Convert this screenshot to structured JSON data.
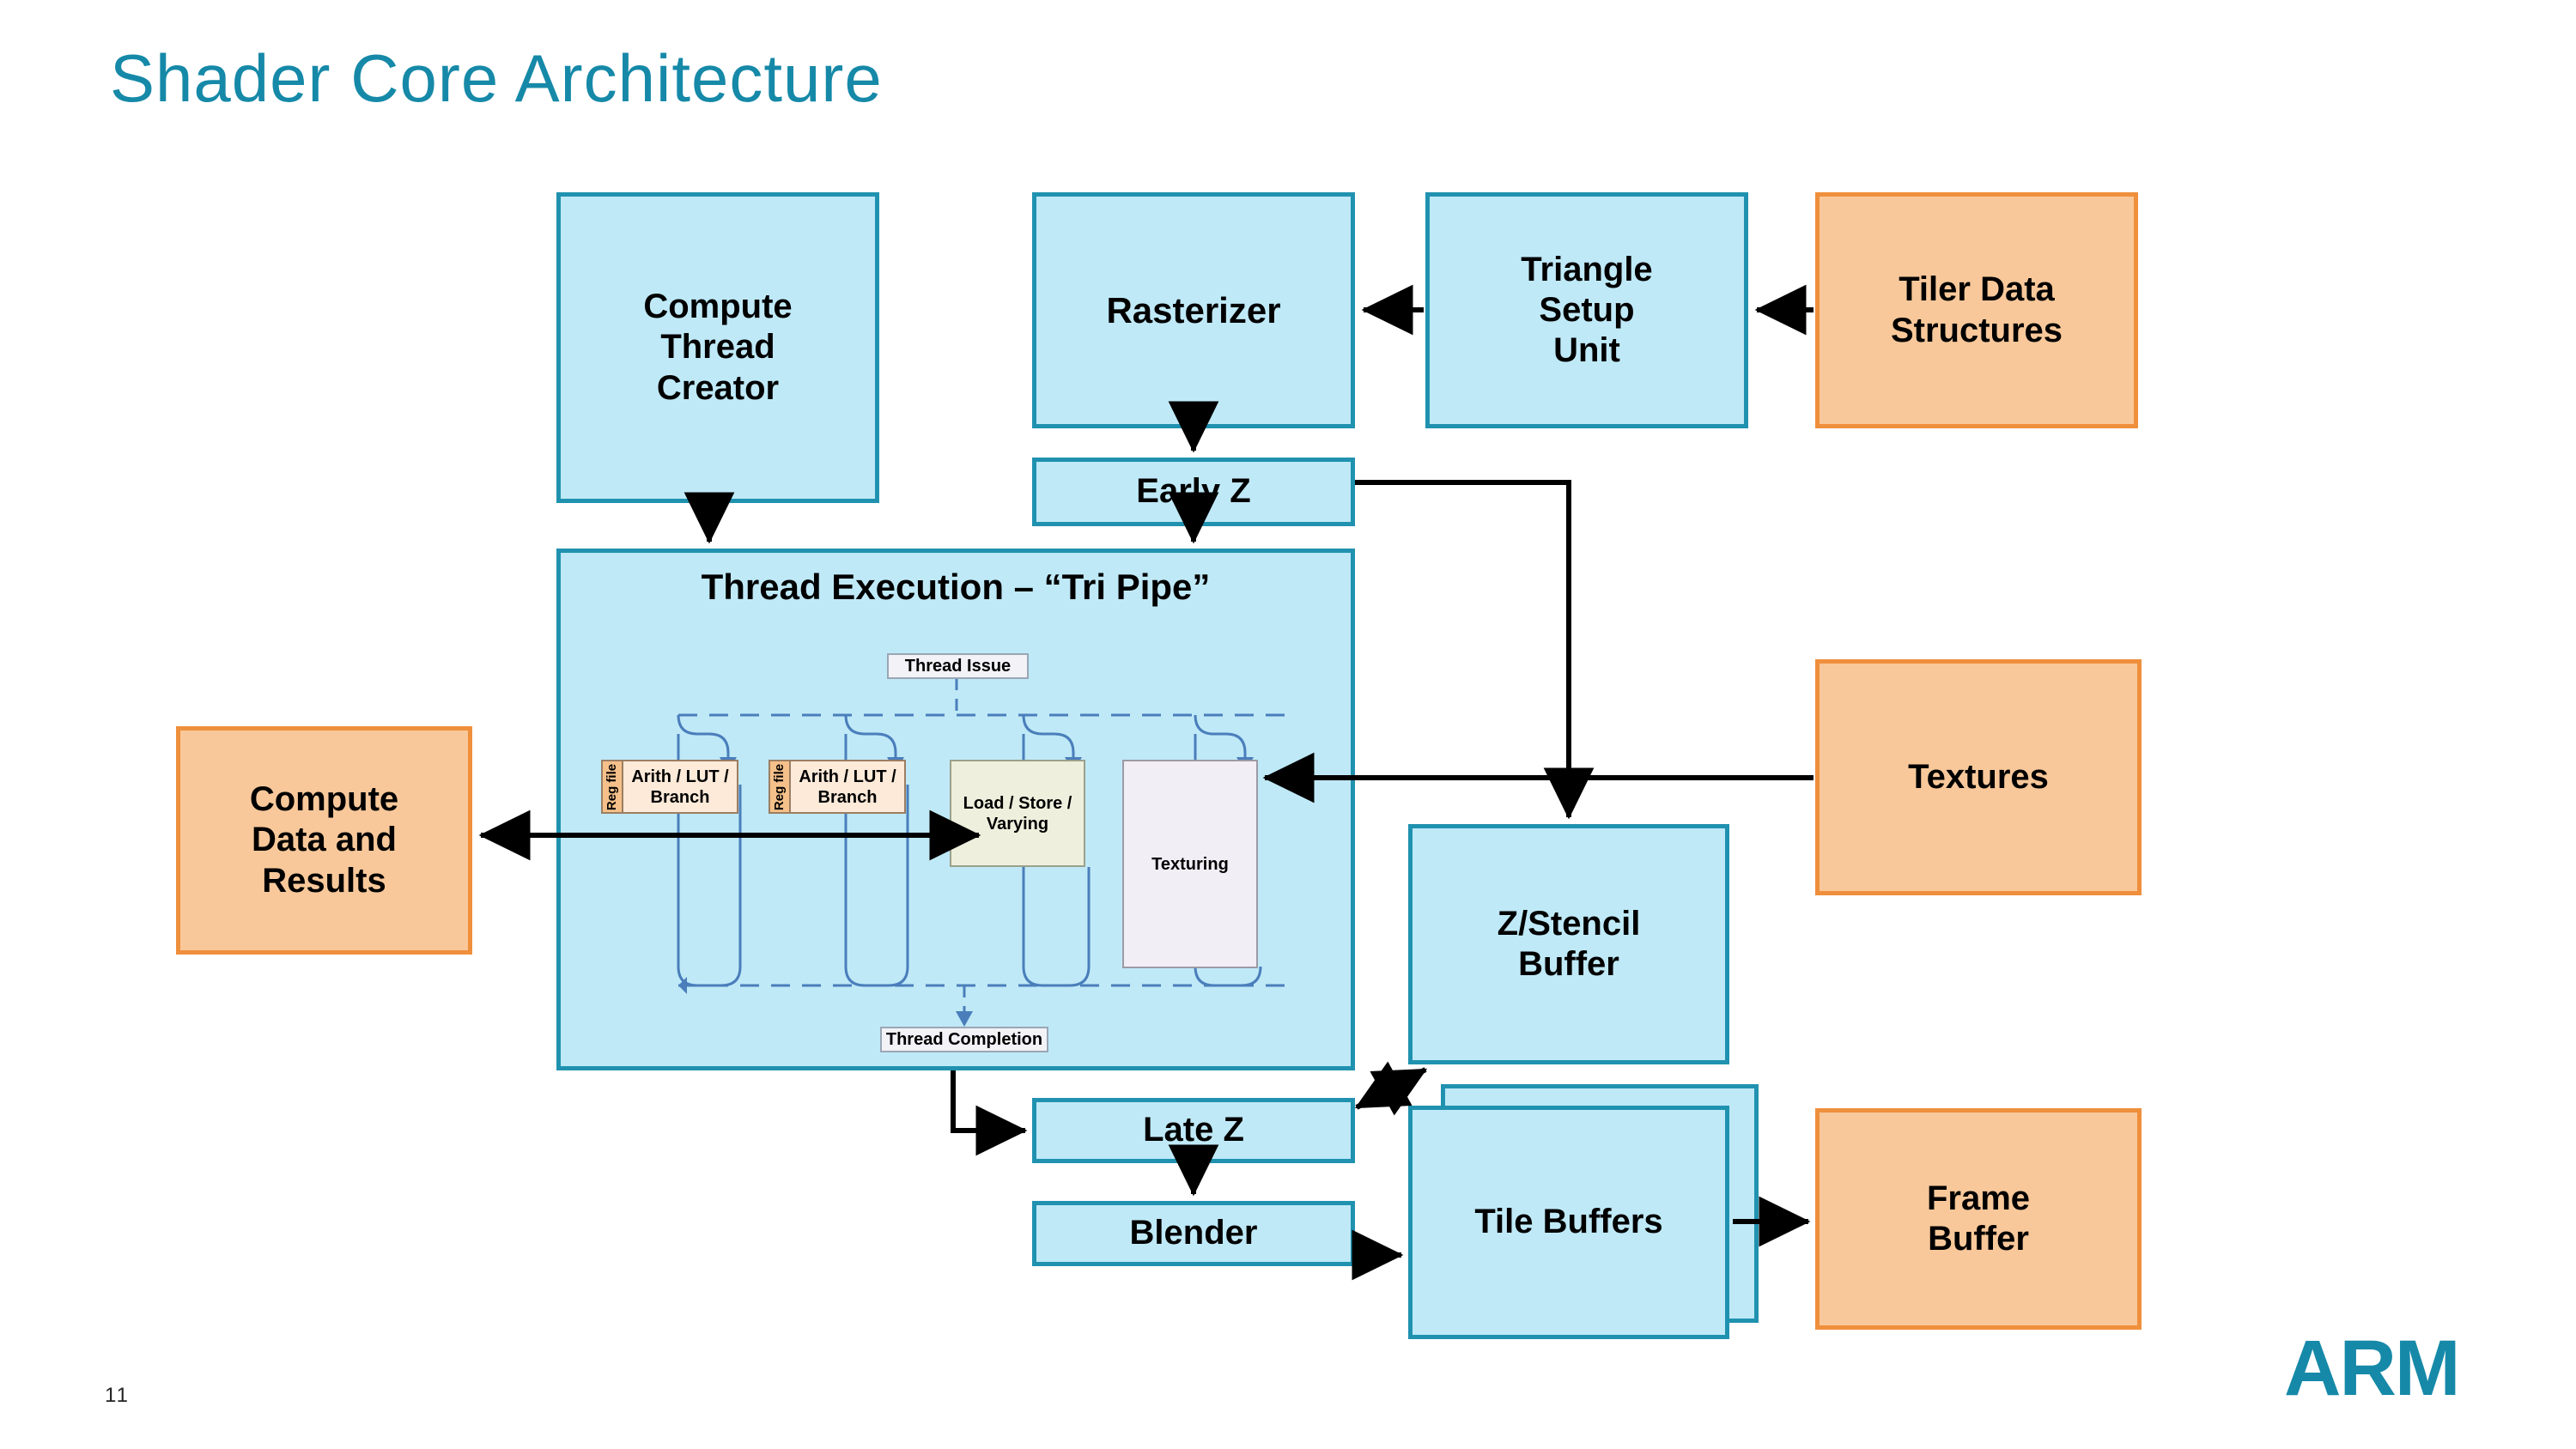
{
  "slide": {
    "title": "Shader Core Architecture",
    "page_number": "11",
    "logo": "ARM",
    "colors": {
      "title_teal": "#1689a8",
      "blue_fill": "#bfe9f7",
      "blue_border": "#2092b0",
      "orange_fill": "#f8c89a",
      "orange_border": "#ef8f3c",
      "arrow_black": "#000000",
      "pipe_connector_blue": "#4a7ebb"
    }
  },
  "diagram": {
    "type": "block-diagram",
    "blocks": [
      {
        "id": "compute_thread_creator",
        "label": "Compute\nThread\nCreator",
        "style": "blue"
      },
      {
        "id": "rasterizer",
        "label": "Rasterizer",
        "style": "blue"
      },
      {
        "id": "triangle_setup_unit",
        "label": "Triangle\nSetup\nUnit",
        "style": "blue"
      },
      {
        "id": "tiler_data_structures",
        "label": "Tiler Data\nStructures",
        "style": "orange"
      },
      {
        "id": "early_z",
        "label": "Early Z",
        "style": "blue"
      },
      {
        "id": "thread_execution",
        "label": "Thread Execution – “Tri Pipe”",
        "style": "blue"
      },
      {
        "id": "compute_data_and_results",
        "label": "Compute\nData and\nResults",
        "style": "orange"
      },
      {
        "id": "textures",
        "label": "Textures",
        "style": "orange"
      },
      {
        "id": "z_stencil_buffer",
        "label": "Z/Stencil\nBuffer",
        "style": "blue"
      },
      {
        "id": "late_z",
        "label": "Late Z",
        "style": "blue"
      },
      {
        "id": "blender",
        "label": "Blender",
        "style": "blue"
      },
      {
        "id": "tile_buffers",
        "label": "Tile Buffers",
        "style": "blue"
      },
      {
        "id": "frame_buffer",
        "label": "Frame\nBuffer",
        "style": "orange"
      }
    ],
    "tri_pipe": {
      "title": "Thread Execution – “Tri Pipe”",
      "thread_issue": "Thread Issue",
      "thread_completion": "Thread Completion",
      "units": [
        {
          "id": "alu0",
          "reg": "Reg file",
          "label": "Arith / LUT /\nBranch"
        },
        {
          "id": "alu1",
          "reg": "Reg file",
          "label": "Arith / LUT /\nBranch"
        },
        {
          "id": "lsv",
          "label": "Load / Store /\nVarying"
        },
        {
          "id": "tex",
          "label": "Texturing"
        }
      ]
    },
    "edges": [
      {
        "from": "tiler_data_structures",
        "to": "triangle_setup_unit"
      },
      {
        "from": "triangle_setup_unit",
        "to": "rasterizer"
      },
      {
        "from": "rasterizer",
        "to": "early_z"
      },
      {
        "from": "early_z",
        "to": "thread_execution"
      },
      {
        "from": "early_z",
        "to": "z_stencil_buffer"
      },
      {
        "from": "compute_thread_creator",
        "to": "thread_execution"
      },
      {
        "from": "thread_execution",
        "to": "compute_data_and_results",
        "bidirectional": true
      },
      {
        "from": "textures",
        "to": "thread_execution"
      },
      {
        "from": "thread_execution",
        "to": "late_z"
      },
      {
        "from": "late_z",
        "to": "z_stencil_buffer",
        "bidirectional": true
      },
      {
        "from": "late_z",
        "to": "blender"
      },
      {
        "from": "blender",
        "to": "tile_buffers"
      },
      {
        "from": "tile_buffers",
        "to": "frame_buffer"
      }
    ]
  }
}
